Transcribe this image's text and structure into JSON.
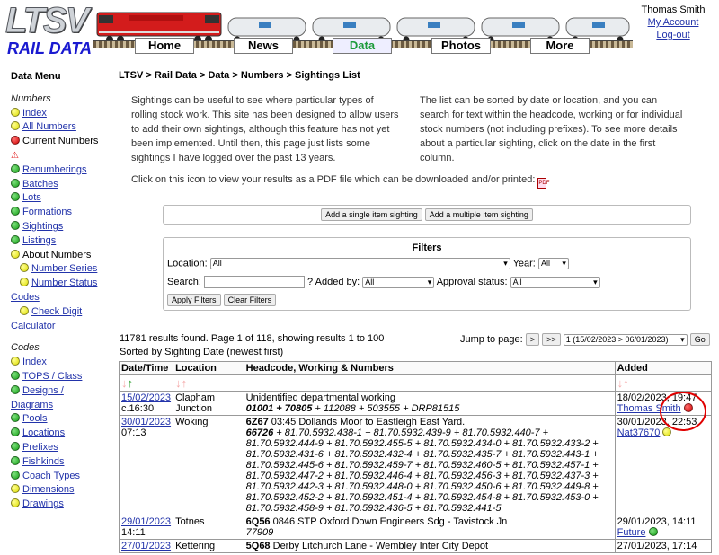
{
  "header": {
    "logo_top": "LTSV",
    "logo_bottom": "RAIL DATA",
    "nav": [
      "Home",
      "News",
      "Data",
      "Photos",
      "More"
    ],
    "active_nav": "Data",
    "user_name": "Thomas Smith",
    "my_account": "My Account",
    "logout": "Log-out"
  },
  "sidebar": {
    "title": "Data Menu",
    "numbers_heading": "Numbers",
    "numbers_items": [
      {
        "label": "Index",
        "dot": "yellow",
        "link": true
      },
      {
        "label": "All Numbers",
        "dot": "yellow",
        "link": true
      },
      {
        "label": "Current Numbers",
        "dot": "red",
        "link": false
      },
      {
        "label": "",
        "dot": "warning",
        "link": false
      },
      {
        "label": "Renumberings",
        "dot": "green",
        "link": true
      },
      {
        "label": "Batches",
        "dot": "green",
        "link": true
      },
      {
        "label": "Lots",
        "dot": "green",
        "link": true
      },
      {
        "label": "Formations",
        "dot": "green",
        "link": true
      },
      {
        "label": "Sightings",
        "dot": "green",
        "link": true
      },
      {
        "label": "Listings",
        "dot": "green",
        "link": true
      },
      {
        "label": "About Numbers",
        "dot": "yellow",
        "link": false
      },
      {
        "label": "Number Series",
        "dot": "yellow",
        "link": true
      },
      {
        "label": "Number Status",
        "dot": "yellow",
        "link": true
      },
      {
        "label": "Codes",
        "dot": "",
        "link": true
      },
      {
        "label": "Check Digit",
        "dot": "yellow",
        "link": true
      },
      {
        "label": "Calculator",
        "dot": "",
        "link": true
      }
    ],
    "codes_heading": "Codes",
    "codes_items": [
      {
        "label": "Index",
        "dot": "yellow"
      },
      {
        "label": "TOPS / Class",
        "dot": "green"
      },
      {
        "label": "Designs /",
        "dot": "green"
      },
      {
        "label": "Diagrams",
        "dot": ""
      },
      {
        "label": "Pools",
        "dot": "green"
      },
      {
        "label": "Locations",
        "dot": "green"
      },
      {
        "label": "Prefixes",
        "dot": "green"
      },
      {
        "label": "Fishkinds",
        "dot": "green"
      },
      {
        "label": "Coach Types",
        "dot": "green"
      },
      {
        "label": "Dimensions",
        "dot": "yellow"
      },
      {
        "label": "Drawings",
        "dot": "yellow"
      }
    ]
  },
  "main": {
    "breadcrumb": "LTSV > Rail Data > Data > Numbers > Sightings List",
    "intro_left": "Sightings can be useful to see where particular types of rolling stock work. This site has been designed to allow users to add their own sightings, although this feature has not yet been implemented. Until then, this page just lists some sightings I have logged over the past 13 years.",
    "intro_right": "The list can be sorted by date or location, and you can search for text within the headcode, working or for individual stock numbers (not including prefixes). To see more details about a particular sighting, click on the date in the first column.",
    "pdf_text": "Click on this icon to view your results as a PDF file which can be downloaded and/or printed:",
    "add_single": "Add a single item sighting",
    "add_multiple": "Add a multiple item sighting",
    "filters": {
      "title": "Filters",
      "location_label": "Location:",
      "location_value": "All",
      "year_label": "Year:",
      "year_value": "All",
      "search_label": "Search:",
      "help": "?",
      "added_by_label": "Added by:",
      "added_by_value": "All",
      "approval_label": "Approval status:",
      "approval_value": "All",
      "apply": "Apply Filters",
      "clear": "Clear Filters"
    },
    "results_text": "11781 results found. Page 1 of 118, showing results 1 to 100",
    "sort_text": "Sorted by Sighting Date (newest first)",
    "jump_label": "Jump to page:",
    "next": ">",
    "last": ">>",
    "page_value": "1 (15/02/2023 > 06/01/2023)",
    "go": "Go"
  },
  "table": {
    "headers": [
      "Date/Time",
      "Location",
      "Headcode, Working & Numbers",
      "Added"
    ],
    "rows": [
      {
        "date": "15/02/2023",
        "time": "c.16:30",
        "location": "Clapham Junction",
        "headcode": "",
        "working": "Unidentified departmental working",
        "numbers_bold": "01001 + 70805",
        "numbers_rest": " + 112088 + 503555 + DRP81515",
        "added": "18/02/2023, 19:47",
        "user": "Thomas Smith",
        "status": "red"
      },
      {
        "date": "30/01/2023",
        "time": "07:13",
        "location": "Woking",
        "headcode": "6Z67",
        "working": " 03:45 Dollands Moor to Eastleigh East Yard.",
        "numbers_bold": "66726",
        "numbers_rest": " + 81.70.5932.438-1 + 81.70.5932.439-9 + 81.70.5932.440-7 + 81.70.5932.444-9 + 81.70.5932.455-5 + 81.70.5932.434-0 + 81.70.5932.433-2 + 81.70.5932.431-6 + 81.70.5932.432-4 + 81.70.5932.435-7 + 81.70.5932.443-1 + 81.70.5932.445-6 + 81.70.5932.459-7 + 81.70.5932.460-5 + 81.70.5932.457-1 + 81.70.5932.447-2 + 81.70.5932.446-4 + 81.70.5932.456-3 + 81.70.5932.437-3 + 81.70.5932.442-3 + 81.70.5932.448-0 + 81.70.5932.450-6 + 81.70.5932.449-8 + 81.70.5932.452-2 + 81.70.5932.451-4 + 81.70.5932.454-8 + 81.70.5932.453-0 + 81.70.5932.458-9 + 81.70.5932.436-5 + 81.70.5932.441-5",
        "added": "30/01/2023, 22:53",
        "user": "Nat37670",
        "status": "yellow"
      },
      {
        "date": "29/01/2023",
        "time": "14:11",
        "location": "Totnes",
        "headcode": "6Q56",
        "working": " 0846 STP Oxford Down Engineers Sdg - Tavistock Jn",
        "numbers_bold": "",
        "numbers_rest": "77909",
        "added": "29/01/2023, 14:11",
        "user": "Future",
        "status": "green"
      },
      {
        "date": "27/01/2023",
        "time": "",
        "location": "Kettering",
        "headcode": "5Q68",
        "working": " Derby Litchurch Lane - Wembley Inter City Depot",
        "numbers_bold": "",
        "numbers_rest": "",
        "added": "27/01/2023, 17:14",
        "user": "",
        "status": ""
      }
    ]
  }
}
